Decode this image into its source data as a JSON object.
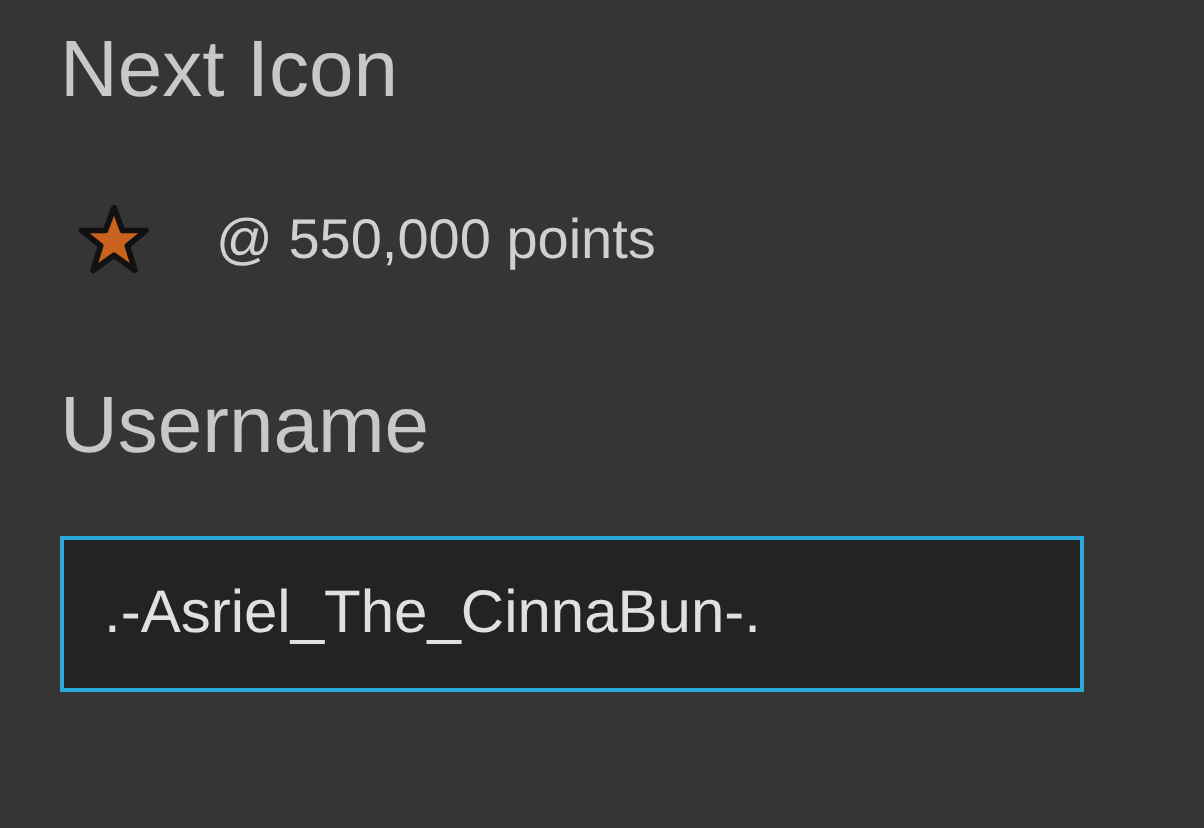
{
  "next_icon": {
    "heading": "Next Icon",
    "requirement": "@ 550,000 points"
  },
  "username": {
    "label": "Username",
    "value": ".-Asriel_The_CinnaBun-."
  }
}
